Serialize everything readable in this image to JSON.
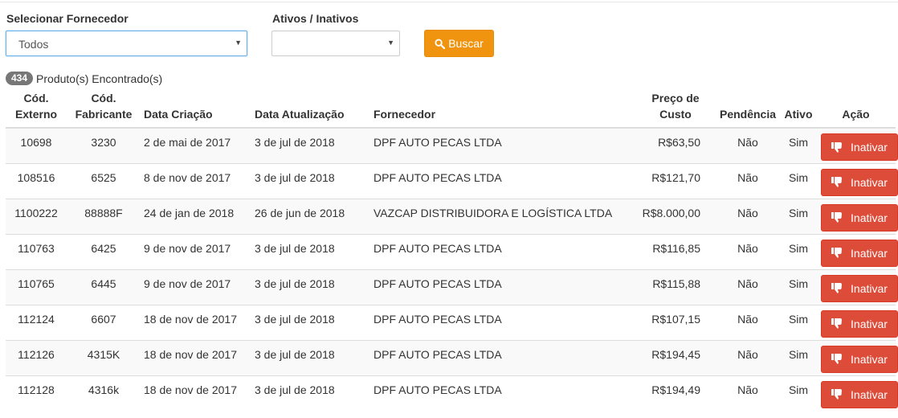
{
  "filters": {
    "supplier_label": "Selecionar Fornecedor",
    "supplier_value": "Todos",
    "status_label": "Ativos / Inativos",
    "status_value": "",
    "search_button": "Buscar"
  },
  "results": {
    "count": "434",
    "text": "Produto(s) Encontrado(s)"
  },
  "table": {
    "headers": {
      "cod_externo_1": "Cód.",
      "cod_externo_2": "Externo",
      "cod_fabricante_1": "Cód.",
      "cod_fabricante_2": "Fabricante",
      "data_criacao": "Data Criação",
      "data_atualizacao": "Data Atualização",
      "fornecedor": "Fornecedor",
      "preco_1": "Preço de",
      "preco_2": "Custo",
      "pendencia": "Pendência",
      "ativo": "Ativo",
      "acao": "Ação"
    },
    "rows": [
      {
        "cod_externo": "10698",
        "cod_fabricante": "3230",
        "data_criacao": "2 de mai de 2017",
        "data_atualizacao": "3 de jul de 2018",
        "fornecedor": "DPF AUTO PECAS LTDA",
        "preco": "R$63,50",
        "pendencia": "Não",
        "ativo": "Sim",
        "acao": "Inativar"
      },
      {
        "cod_externo": "108516",
        "cod_fabricante": "6525",
        "data_criacao": "8 de nov de 2017",
        "data_atualizacao": "3 de jul de 2018",
        "fornecedor": "DPF AUTO PECAS LTDA",
        "preco": "R$121,70",
        "pendencia": "Não",
        "ativo": "Sim",
        "acao": "Inativar"
      },
      {
        "cod_externo": "1100222",
        "cod_fabricante": "88888F",
        "data_criacao": "24 de jan de 2018",
        "data_atualizacao": "26 de jun de 2018",
        "fornecedor": "VAZCAP DISTRIBUIDORA E LOGÍSTICA LTDA",
        "preco": "R$8.000,00",
        "pendencia": "Não",
        "ativo": "Sim",
        "acao": "Inativar"
      },
      {
        "cod_externo": "110763",
        "cod_fabricante": "6425",
        "data_criacao": "9 de nov de 2017",
        "data_atualizacao": "3 de jul de 2018",
        "fornecedor": "DPF AUTO PECAS LTDA",
        "preco": "R$116,85",
        "pendencia": "Não",
        "ativo": "Sim",
        "acao": "Inativar"
      },
      {
        "cod_externo": "110765",
        "cod_fabricante": "6445",
        "data_criacao": "9 de nov de 2017",
        "data_atualizacao": "3 de jul de 2018",
        "fornecedor": "DPF AUTO PECAS LTDA",
        "preco": "R$115,88",
        "pendencia": "Não",
        "ativo": "Sim",
        "acao": "Inativar"
      },
      {
        "cod_externo": "112124",
        "cod_fabricante": "6607",
        "data_criacao": "18 de nov de 2017",
        "data_atualizacao": "3 de jul de 2018",
        "fornecedor": "DPF AUTO PECAS LTDA",
        "preco": "R$107,15",
        "pendencia": "Não",
        "ativo": "Sim",
        "acao": "Inativar"
      },
      {
        "cod_externo": "112126",
        "cod_fabricante": "4315K",
        "data_criacao": "18 de nov de 2017",
        "data_atualizacao": "3 de jul de 2018",
        "fornecedor": "DPF AUTO PECAS LTDA",
        "preco": "R$194,45",
        "pendencia": "Não",
        "ativo": "Sim",
        "acao": "Inativar"
      },
      {
        "cod_externo": "112128",
        "cod_fabricante": "4316k",
        "data_criacao": "18 de nov de 2017",
        "data_atualizacao": "3 de jul de 2018",
        "fornecedor": "DPF AUTO PECAS LTDA",
        "preco": "R$194,49",
        "pendencia": "Não",
        "ativo": "Sim",
        "acao": "Inativar"
      }
    ]
  },
  "icons": {
    "search": "search-icon",
    "inactivate": "thumbs-down-icon",
    "dropdown": "caret-down-icon"
  },
  "colors": {
    "primary_orange": "#f0940f",
    "danger_red": "#dd4b39",
    "badge_gray": "#777777",
    "focus_blue": "#66afe9"
  }
}
